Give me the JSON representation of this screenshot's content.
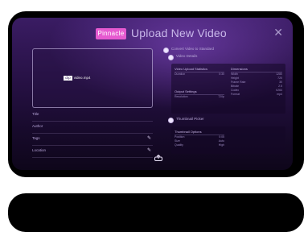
{
  "header": {
    "brand_label": "Pinnacle",
    "title": "Upload New Video",
    "close_label": "✕"
  },
  "preview": {
    "chip_name": "clip",
    "chip_label": "video.mp4"
  },
  "fields": [
    {
      "label": "Title",
      "editable": false
    },
    {
      "label": "Author",
      "editable": false
    },
    {
      "label": "Tags",
      "editable": true
    },
    {
      "label": "Location",
      "editable": true
    }
  ],
  "options": {
    "option1_label": "Convert Video to Standard",
    "option2_label": "Video Details",
    "option3_label": "Thumbnail Picker"
  },
  "stats_table": {
    "col1_header": "Video Upload Statistics",
    "col1_rows": [
      [
        "Duration",
        "0:30"
      ],
      [
        "",
        ""
      ],
      [
        "",
        ""
      ]
    ],
    "col1_header2": "Output Settings",
    "col1_rows2": [
      [
        "Resolution",
        "720p"
      ]
    ],
    "col2_header": "Dimensions",
    "col2_rows": [
      [
        "Width",
        "1280"
      ],
      [
        "Height",
        "720"
      ],
      [
        "Frame Rate",
        "30"
      ],
      [
        "Bitrate",
        "2.5"
      ],
      [
        "Codec",
        "h264"
      ],
      [
        "Format",
        "mp4"
      ]
    ]
  },
  "thumb_table": {
    "header": "Thumbnail Options",
    "rows": [
      [
        "Position",
        "0:05"
      ],
      [
        "Size",
        "Auto"
      ],
      [
        "Quality",
        "High"
      ]
    ]
  },
  "upload_icon": "upload-icon",
  "colors": {
    "brand_accent": "#e65ad0",
    "bg_top": "#3a1c63",
    "bg_bottom": "#0e061a"
  }
}
